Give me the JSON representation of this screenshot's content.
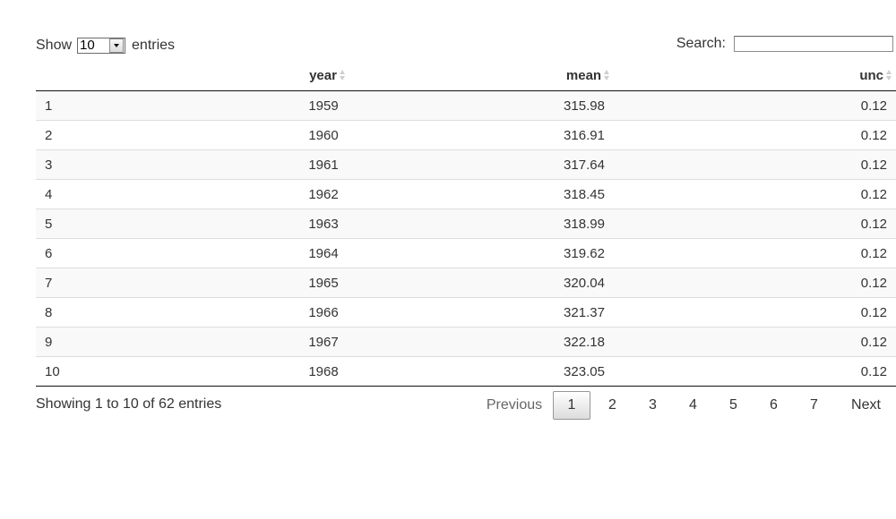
{
  "length": {
    "show_label": "Show",
    "selected": "10",
    "entries_label": "entries"
  },
  "search": {
    "label": "Search:",
    "value": ""
  },
  "table": {
    "columns": [
      "",
      "year",
      "mean",
      "unc"
    ],
    "rows": [
      [
        "1",
        "1959",
        "315.98",
        "0.12"
      ],
      [
        "2",
        "1960",
        "316.91",
        "0.12"
      ],
      [
        "3",
        "1961",
        "317.64",
        "0.12"
      ],
      [
        "4",
        "1962",
        "318.45",
        "0.12"
      ],
      [
        "5",
        "1963",
        "318.99",
        "0.12"
      ],
      [
        "6",
        "1964",
        "319.62",
        "0.12"
      ],
      [
        "7",
        "1965",
        "320.04",
        "0.12"
      ],
      [
        "8",
        "1966",
        "321.37",
        "0.12"
      ],
      [
        "9",
        "1967",
        "322.18",
        "0.12"
      ],
      [
        "10",
        "1968",
        "323.05",
        "0.12"
      ]
    ]
  },
  "info": "Showing 1 to 10 of 62 entries",
  "pagination": {
    "previous": "Previous",
    "pages": [
      "1",
      "2",
      "3",
      "4",
      "5",
      "6",
      "7"
    ],
    "current": "1",
    "next": "Next"
  },
  "icons": {
    "sort": "sort-both-icon",
    "dropdown": "chevron-down-icon"
  }
}
